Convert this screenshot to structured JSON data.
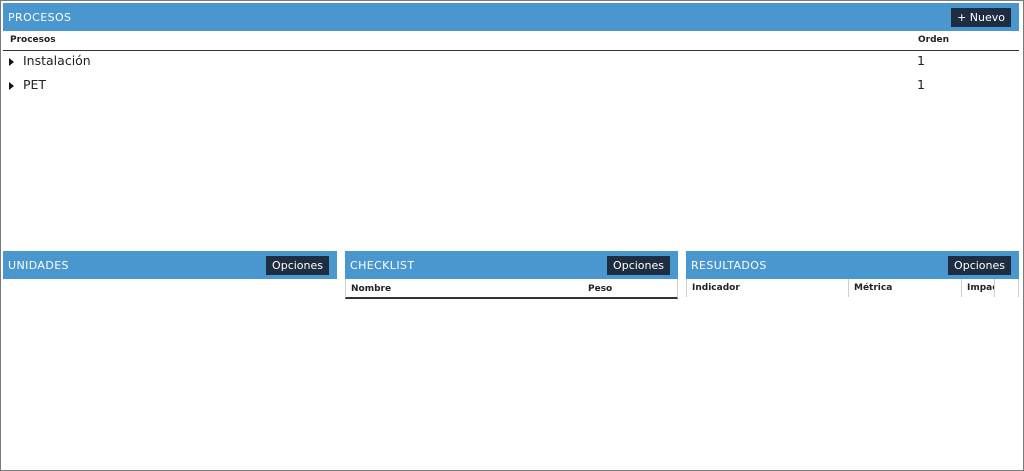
{
  "procesos": {
    "title": "PROCESOS",
    "new_button": "+ Nuevo",
    "columns": [
      "Procesos",
      "Orden"
    ],
    "rows": [
      {
        "name": "Instalación",
        "orden": "1"
      },
      {
        "name": "PET",
        "orden": "1"
      }
    ]
  },
  "unidades": {
    "title": "UNIDADES",
    "options_button": "Opciones"
  },
  "checklist": {
    "title": "CHECKLIST",
    "options_button": "Opciones",
    "columns": [
      "Nombre",
      "Peso"
    ]
  },
  "resultados": {
    "title": "RESULTADOS",
    "options_button": "Opciones",
    "columns": [
      "Indicador",
      "Métrica",
      "Impac"
    ]
  }
}
